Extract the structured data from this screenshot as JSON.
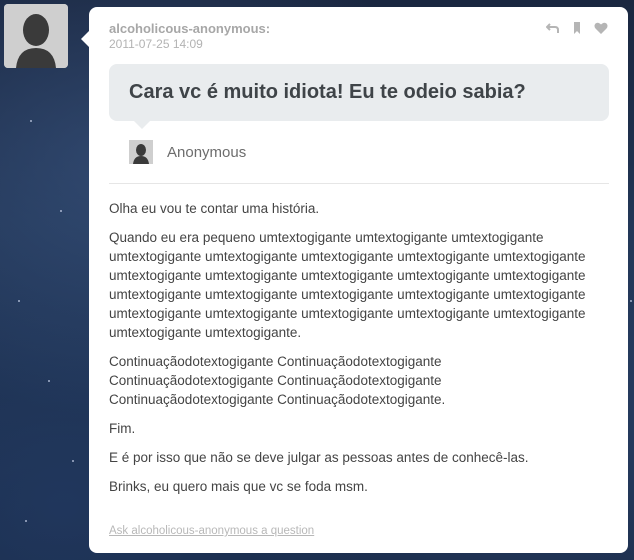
{
  "post": {
    "username": "alcoholicous-anonymous:",
    "timestamp": "2011-07-25 14:09",
    "question": "Cara vc é muito idiota! Eu te odeio sabia?",
    "asker": "Anonymous",
    "answer": {
      "paragraphs": [
        "Olha eu vou te contar uma história.",
        "Quando eu era pequeno umtextogigante umtextogigante umtextogigante umtextogigante umtextogigante umtextogigante umtextogigante umtextogigante umtextogigante umtextogigante umtextogigante umtextogigante umtextogigante umtextogigante umtextogigante umtextogigante umtextogigante umtextogigante umtextogigante umtextogigante umtextogigante umtextogigante umtextogigante umtextogigante umtextogigante.",
        "Continuaçãodotextogigante Continuaçãodotextogigante Continuaçãodotextogigante Continuaçãodotextogigante Continuaçãodotextogigante Continuaçãodotextogigante.",
        "Fim.",
        "E é por isso que não se deve julgar as pessoas antes de conhecê-las.",
        "Brinks, eu quero mais que vc se foda msm."
      ]
    },
    "ask_link": "Ask alcoholicous-anonymous a question",
    "actions": {
      "reblog_icon": "reblog-icon",
      "bookmark_icon": "bookmark-icon",
      "like_icon": "heart-icon"
    }
  }
}
